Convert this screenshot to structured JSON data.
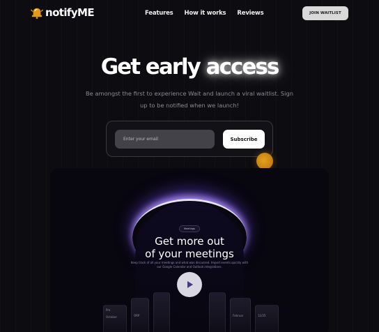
{
  "nav": {
    "logo_text": "notifyME",
    "links": [
      "Features",
      "How it works",
      "Reviews"
    ],
    "join_label": "JOIN WAITLIST"
  },
  "hero": {
    "title_part1": "Get early",
    "title_part2": "access",
    "subtitle": "Be amongst the first to experience Wait and launch a viral waitlist. Sign up to be notified when we launch!"
  },
  "form": {
    "email_placeholder": "Enter your email",
    "subscribe_label": "Subscribe"
  },
  "preview": {
    "badge": "Meetings",
    "title_line1": "Get more out",
    "title_line2": "of your meetings",
    "description": "Keep track of all your meetings and what was discussed. Import events quickly with our Google Calendar and Outlook integrations.",
    "panel_labels": [
      "Pro",
      "October",
      "ORP",
      "Februar",
      "12/25"
    ]
  },
  "colors": {
    "background": "#0d0c10",
    "accent_orange": "#d58f15",
    "glow_purple": "#7b5cff"
  },
  "icons": {
    "logo": "bell-icon",
    "play": "play-icon"
  }
}
